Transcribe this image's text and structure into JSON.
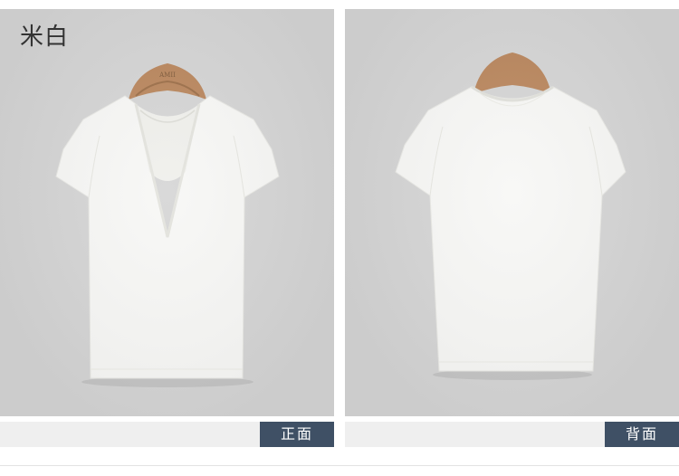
{
  "color_name": "米白",
  "hanger_brand": "AMII",
  "views": [
    {
      "label": "正面"
    },
    {
      "label": "背面"
    }
  ],
  "colors": {
    "panel_bg": "#d4d4d4",
    "label_bg": "#3f5065",
    "hanger": "#b8845a",
    "garment": "#f7f7f5"
  }
}
